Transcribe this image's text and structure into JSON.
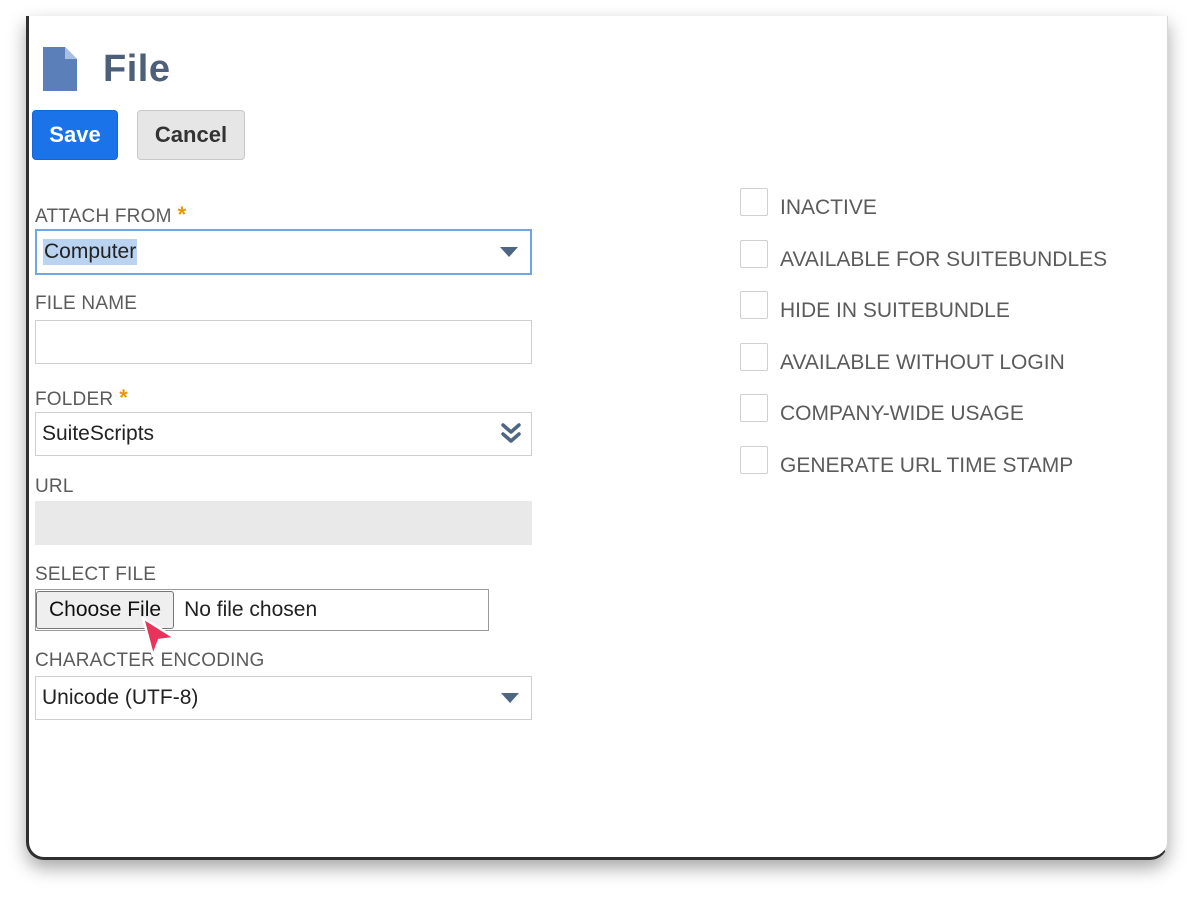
{
  "page": {
    "title": "File",
    "icon": "document-icon"
  },
  "toolbar": {
    "save_label": "Save",
    "cancel_label": "Cancel"
  },
  "form": {
    "attach_from": {
      "label": "ATTACH FROM",
      "required_mark": "*",
      "value": "Computer"
    },
    "file_name": {
      "label": "FILE NAME",
      "value": ""
    },
    "folder": {
      "label": "FOLDER",
      "required_mark": "*",
      "value": "SuiteScripts"
    },
    "url": {
      "label": "URL",
      "value": ""
    },
    "select_file": {
      "label": "SELECT FILE",
      "button_label": "Choose File",
      "status": "No file chosen"
    },
    "character_encoding": {
      "label": "CHARACTER ENCODING",
      "value": "Unicode (UTF-8)"
    }
  },
  "checkboxes": [
    {
      "label": "INACTIVE",
      "checked": false
    },
    {
      "label": "AVAILABLE FOR SUITEBUNDLES",
      "checked": false
    },
    {
      "label": "HIDE IN SUITEBUNDLE",
      "checked": false
    },
    {
      "label": "AVAILABLE WITHOUT LOGIN",
      "checked": false
    },
    {
      "label": "COMPANY-WIDE USAGE",
      "checked": false
    },
    {
      "label": "GENERATE URL TIME STAMP",
      "checked": false
    }
  ],
  "colors": {
    "primary": "#1a73e8",
    "title": "#4d5f79",
    "required": "#e39a00",
    "cursor": "#e8335a"
  }
}
